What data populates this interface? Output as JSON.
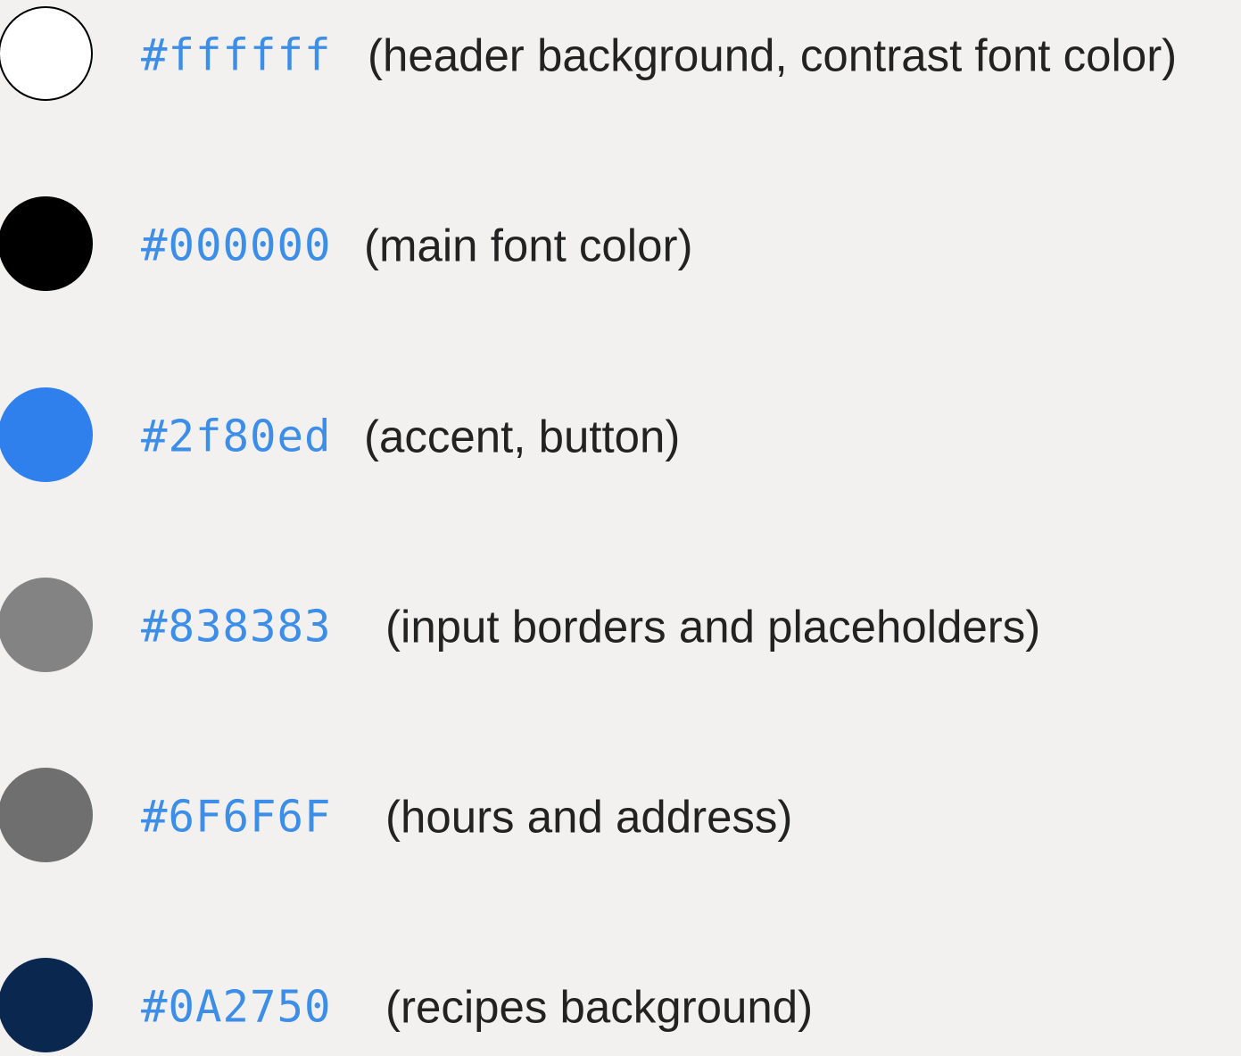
{
  "palette": [
    {
      "swatch_color": "#ffffff",
      "hex": "#ffffff",
      "description": "(header background, contrast font color)"
    },
    {
      "swatch_color": "#000000",
      "hex": "#000000",
      "description": "(main font color)"
    },
    {
      "swatch_color": "#2f80ed",
      "hex": "#2f80ed",
      "description": "(accent, button)"
    },
    {
      "swatch_color": "#838383",
      "hex": "#838383",
      "description": "(input borders and placeholders)"
    },
    {
      "swatch_color": "#6f6f6f",
      "hex": "#6F6F6F",
      "description": "(hours and address)"
    },
    {
      "swatch_color": "#0a2750",
      "hex": "#0A2750",
      "description": "(recipes background)"
    }
  ],
  "colors": {
    "background": "#f2f1ef",
    "hex_text": "#3d8ee8",
    "description_text": "#222222"
  }
}
